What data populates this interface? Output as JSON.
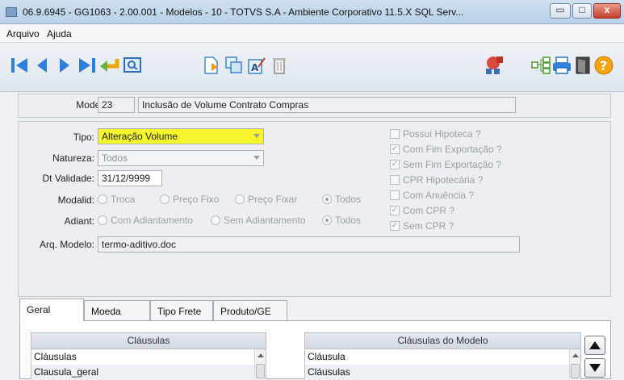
{
  "window": {
    "title": "06.9.6945 - GG1063 - 2.00.001 - Modelos - 10 - TOTVS S.A - Ambiente Corporativo 11.5.X SQL Serv...",
    "minimize": "▭",
    "maximize": "□",
    "close": "x"
  },
  "menu": {
    "items": [
      "Arquivo",
      "Ajuda"
    ]
  },
  "toolbar": {
    "icons": [
      "first-record-icon",
      "previous-record-icon",
      "next-record-icon",
      "last-record-icon",
      "return-icon",
      "zoom-icon",
      "new-record-icon",
      "copy-icon",
      "edit-icon",
      "delete-icon",
      "network-icon",
      "tree-icon",
      "print-icon",
      "exit-icon",
      "help-icon"
    ],
    "help_glyph": "?"
  },
  "header": {
    "modelo_label": "Modelo:",
    "modelo_code": "23",
    "modelo_desc": "Inclusão de Volume Contrato Compras"
  },
  "form": {
    "tipo": {
      "label": "Tipo:",
      "value": "Alteração Volume",
      "highlight": "#f5f52e"
    },
    "natureza": {
      "label": "Natureza:",
      "value": "Todos"
    },
    "dt_validade": {
      "label": "Dt Validade:",
      "value": "31/12/9999"
    },
    "modalid": {
      "label": "Modalid:",
      "options": [
        "Troca",
        "Preço Fixo",
        "Preço Fixar",
        "Todos"
      ],
      "selected": "Todos"
    },
    "adiant": {
      "label": "Adiant:",
      "options": [
        "Com Adiantamento",
        "Sem Adiantamento",
        "Todos"
      ],
      "selected": "Todos"
    },
    "arq_modelo": {
      "label": "Arq. Modelo:",
      "value": "termo-aditivo.doc"
    },
    "checks": [
      {
        "label": "Possui Hipoteca ?",
        "checked": false
      },
      {
        "label": "Com Fim Exportação ?",
        "checked": true
      },
      {
        "label": "Sem Fim Exportação ?",
        "checked": true
      },
      {
        "label": "CPR Hipotecária ?",
        "checked": false
      },
      {
        "label": "Com Anuência ?",
        "checked": false
      },
      {
        "label": "Com CPR ?",
        "checked": true
      },
      {
        "label": "Sem CPR ?",
        "checked": true
      }
    ],
    "check_mark": "✓"
  },
  "tabs": [
    "Geral",
    "Moeda",
    "Tipo Frete",
    "Produto/GE"
  ],
  "clausulas": {
    "header": "Cláusulas",
    "rows": [
      "Cláusulas",
      "Clausula_geral"
    ]
  },
  "clausulas_modelo": {
    "header": "Cláusulas do Modelo",
    "rows": [
      "Cláusula",
      "Cláusulas"
    ]
  }
}
